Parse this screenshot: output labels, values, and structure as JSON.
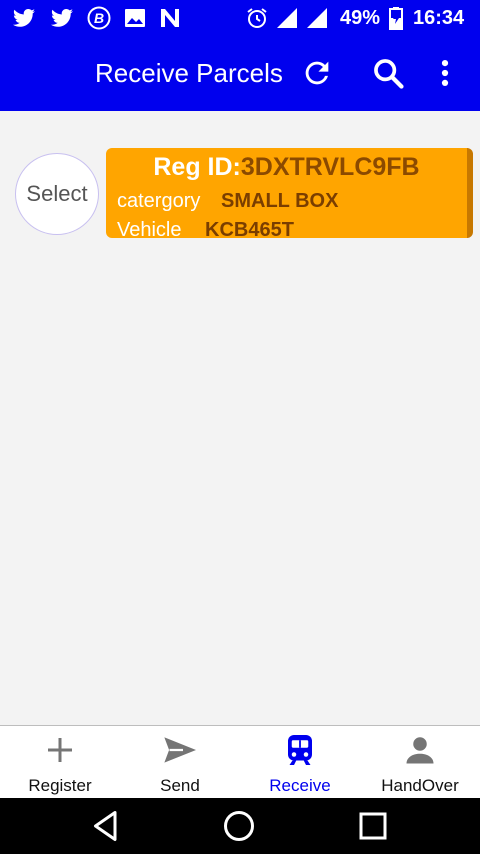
{
  "status_bar": {
    "icons": [
      "twitter-icon",
      "twitter-icon",
      "bitcoin-wallet-icon",
      "image-icon",
      "n-app-icon",
      "alarm-icon",
      "signal-icon",
      "signal-icon",
      "battery-icon"
    ],
    "battery": "49%",
    "time": "16:34"
  },
  "app_bar": {
    "title": "Receive Parcels",
    "actions": [
      "refresh-icon",
      "search-icon",
      "more-vert-icon"
    ],
    "color": "#0000ee"
  },
  "parcel": {
    "select_label": "Select",
    "reg_label": "Reg ID:",
    "reg_id": "3DXTRVLC9FB",
    "category_label": "catergory",
    "category": "SMALL BOX",
    "vehicle_label": "Vehicle",
    "vehicle": "KCB465T",
    "card_color": "#ffa500"
  },
  "bottom_nav": {
    "items": [
      {
        "label": "Register",
        "icon": "plus-icon"
      },
      {
        "label": "Send",
        "icon": "send-icon"
      },
      {
        "label": "Receive",
        "icon": "train-icon",
        "active": true
      },
      {
        "label": "HandOver",
        "icon": "person-icon"
      }
    ],
    "active_color": "#0000ee"
  },
  "system_nav": [
    "back-icon",
    "home-icon",
    "recents-icon"
  ]
}
